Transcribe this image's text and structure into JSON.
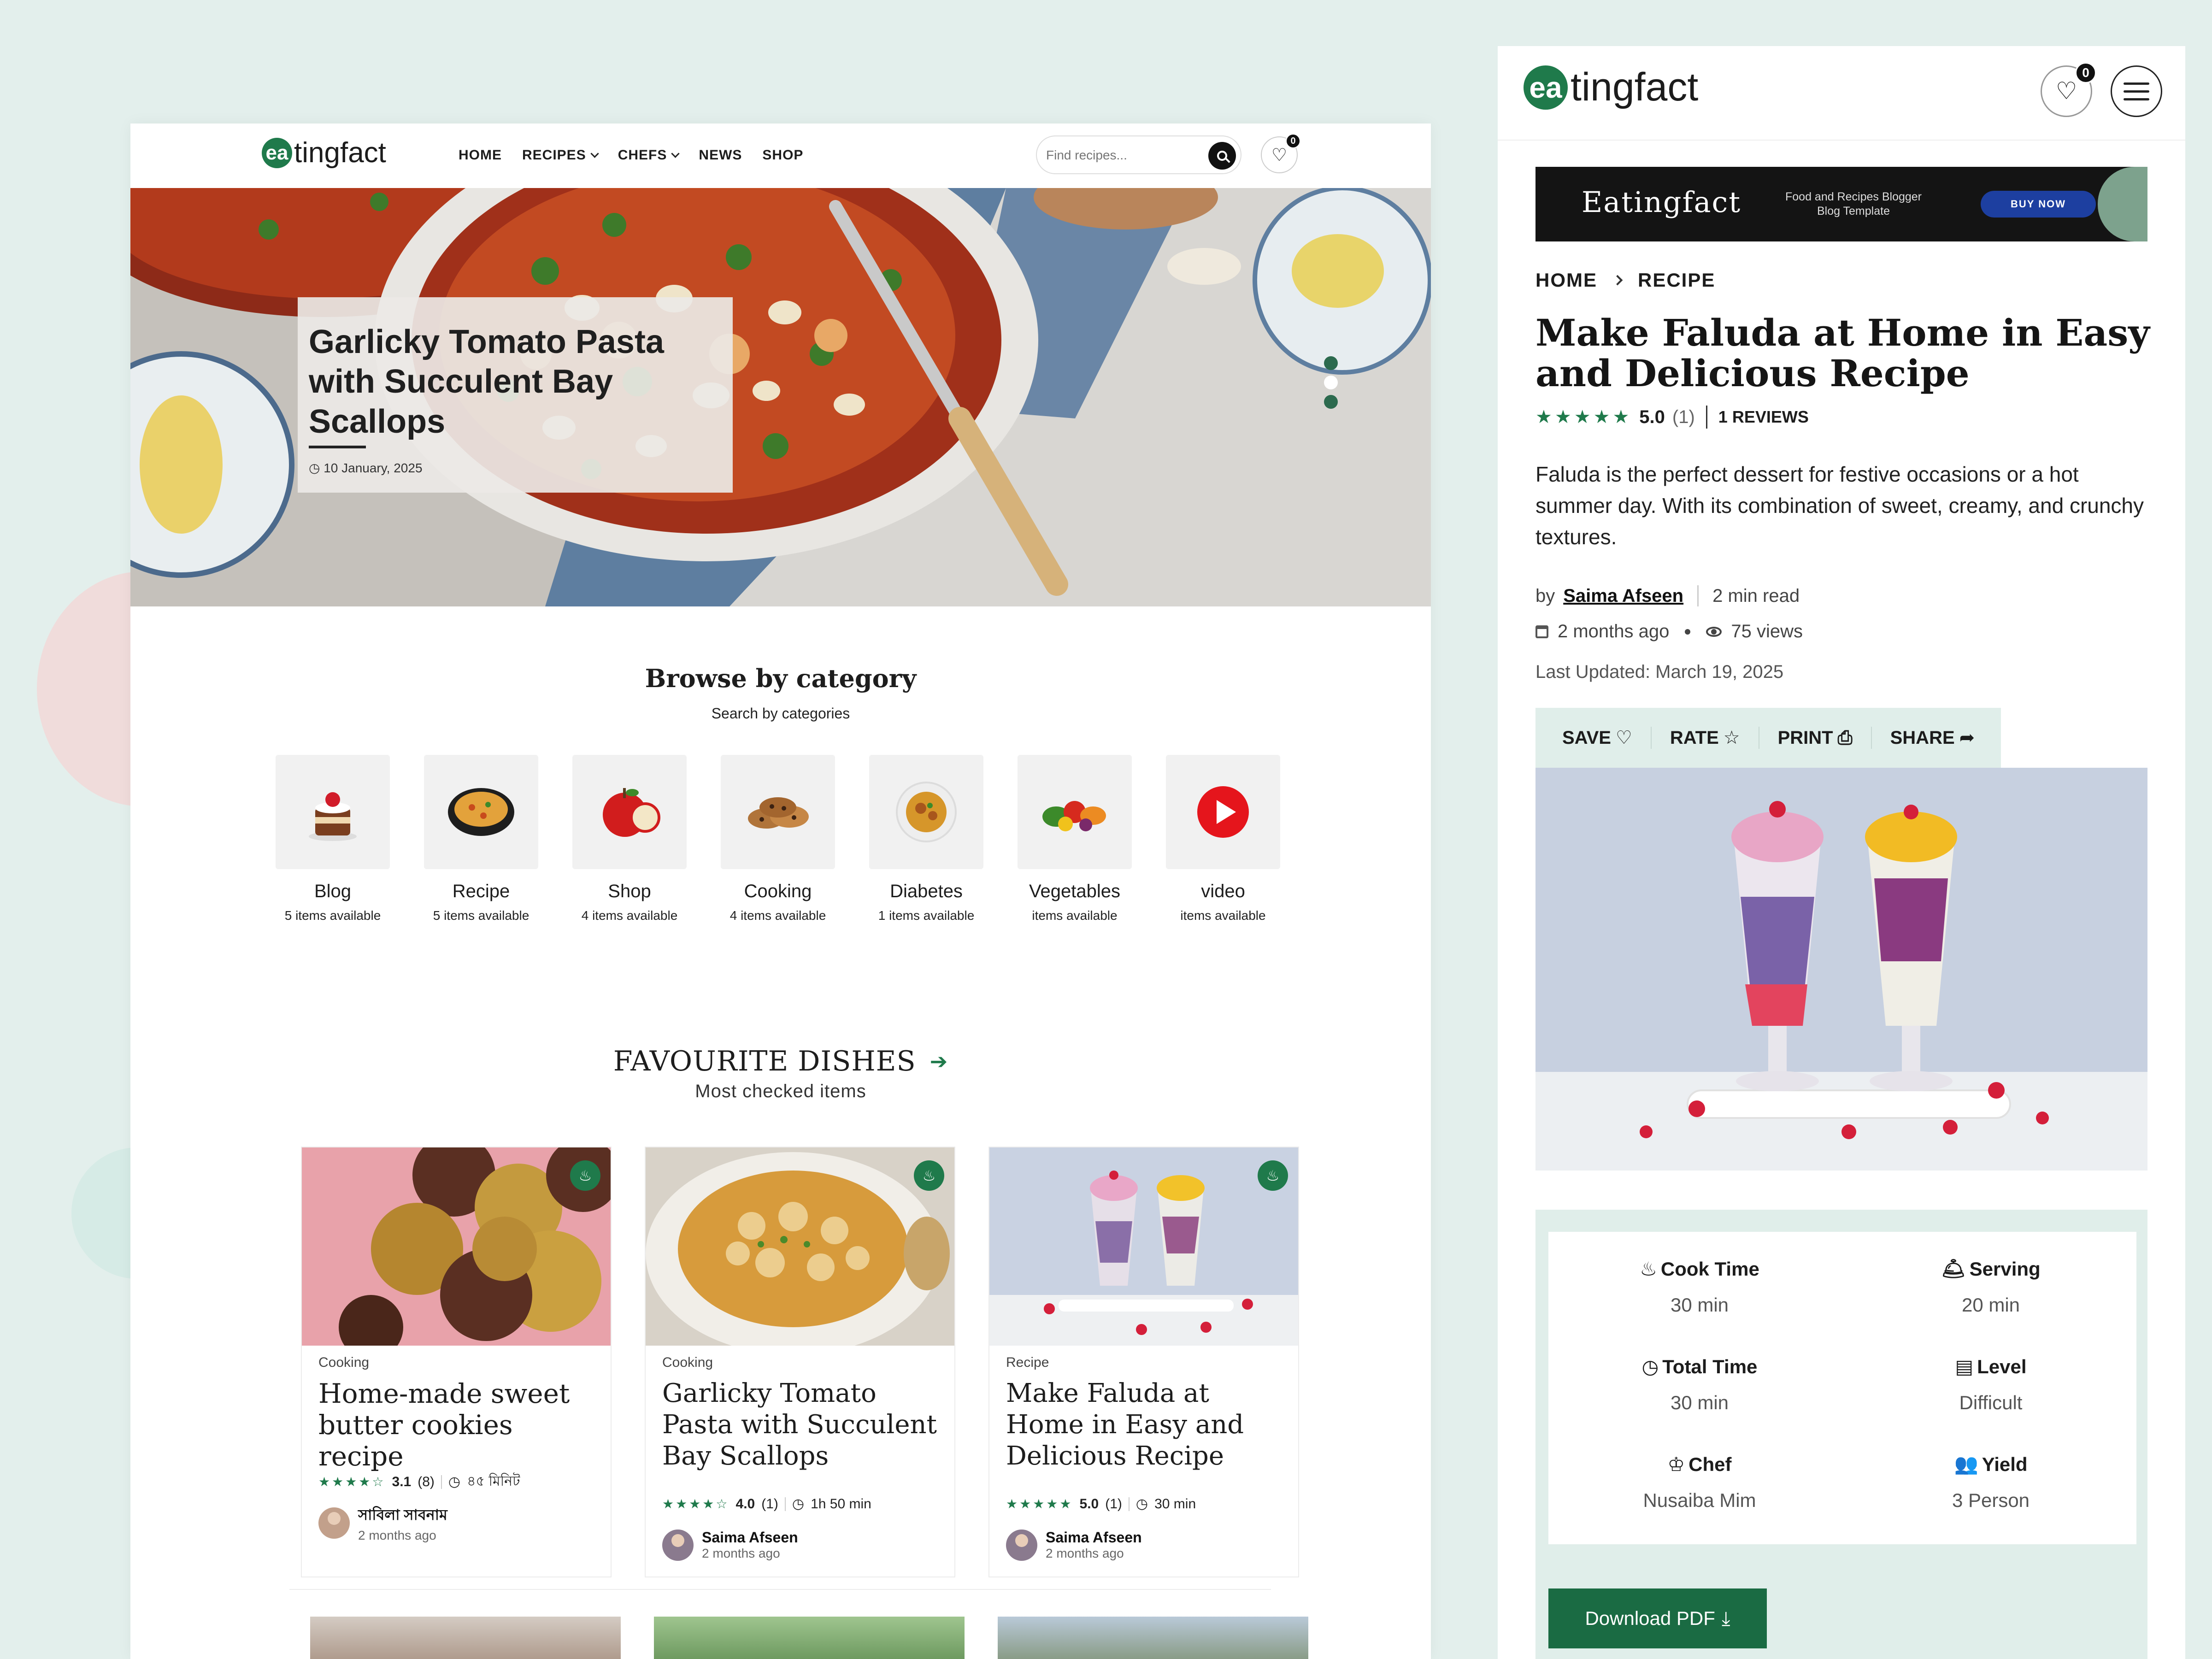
{
  "brand": {
    "badge": "ea",
    "rest": "tingfact"
  },
  "colors": {
    "accent": "#1f7a4b",
    "background": "#e3efec",
    "panel": "#e0eeea"
  },
  "left": {
    "nav": [
      {
        "label": "HOME",
        "dropdown": false
      },
      {
        "label": "RECIPES",
        "dropdown": true
      },
      {
        "label": "CHEFS",
        "dropdown": true
      },
      {
        "label": "NEWS",
        "dropdown": false
      },
      {
        "label": "SHOP",
        "dropdown": false
      }
    ],
    "search": {
      "placeholder": "Find recipes..."
    },
    "favorites_count": "0",
    "hero": {
      "title": "Garlicky Tomato Pasta with Succulent Bay Scallops",
      "date": "10 January, 2025"
    },
    "browse": {
      "title": "Browse by category",
      "subtitle": "Search by categories",
      "categories": [
        {
          "name": "Blog",
          "count_num": "5",
          "count_text": "items available",
          "icon": "cake-icon"
        },
        {
          "name": "Recipe",
          "count_num": "5",
          "count_text": "items available",
          "icon": "rice-bowl-icon"
        },
        {
          "name": "Shop",
          "count_num": "4",
          "count_text": "items available",
          "icon": "apple-icon"
        },
        {
          "name": "Cooking",
          "count_num": "4",
          "count_text": "items available",
          "icon": "cookies-icon"
        },
        {
          "name": "Diabetes",
          "count_num": "1",
          "count_text": "items available",
          "icon": "curry-plate-icon"
        },
        {
          "name": "Vegetables",
          "count_num": "",
          "count_text": "items available",
          "icon": "vegetables-icon"
        },
        {
          "name": "video",
          "count_num": "",
          "count_text": "items available",
          "icon": "play-icon"
        }
      ]
    },
    "favourites": {
      "title": "FAVOURITE DISHES",
      "subtitle": "Most checked items",
      "cards": [
        {
          "category": "Cooking",
          "title": "Home-made sweet butter cookies recipe",
          "rating": "3.1",
          "reviews": "(8)",
          "time": "৪৫ মিনিট",
          "author": "সাবিলা সাবনাম",
          "ago": "2 months ago",
          "stars": "★★★★☆"
        },
        {
          "category": "Cooking",
          "title": "Garlicky Tomato Pasta with Succulent Bay Scallops",
          "rating": "4.0",
          "reviews": "(1)",
          "time": "1h 50 min",
          "author": "Saima Afseen",
          "ago": "2 months ago",
          "stars": "★★★★☆"
        },
        {
          "category": "Recipe",
          "title": "Make Faluda at Home in Easy and Delicious Recipe",
          "rating": "5.0",
          "reviews": "(1)",
          "time": "30 min",
          "author": "Saima Afseen",
          "ago": "2 months ago",
          "stars": "★★★★★"
        }
      ]
    }
  },
  "right": {
    "favorites_count": "0",
    "banner": {
      "title": "Eatingfact",
      "subtitle": "Food and Recipes Blogger Blog Template",
      "button": "BUY NOW"
    },
    "breadcrumb": [
      "HOME",
      "RECIPE"
    ],
    "title": "Make Faluda at Home in Easy and Delicious Recipe",
    "rating": {
      "stars": "★★★★★",
      "value": "5.0",
      "count": "(1)",
      "reviews": "1 REVIEWS"
    },
    "description": "Faluda is the perfect dessert for festive occasions or a hot summer day. With its combination of sweet, creamy, and crunchy textures.",
    "byline": {
      "by": "by",
      "author": "Saima Afseen",
      "read": "2 min read"
    },
    "posted": "2 months ago",
    "views": "75 views",
    "updated": "Last Updated: March 19, 2025",
    "actions": [
      {
        "label": "SAVE",
        "icon": "♡",
        "icon_name": "heart-icon"
      },
      {
        "label": "RATE",
        "icon": "☆",
        "icon_name": "star-icon"
      },
      {
        "label": "PRINT",
        "icon": "⎙",
        "icon_name": "printer-icon"
      },
      {
        "label": "SHARE",
        "icon": "➦",
        "icon_name": "share-icon"
      }
    ],
    "stats": [
      {
        "key": "Cook Time",
        "value": "30 min",
        "icon": "♨"
      },
      {
        "key": "Serving",
        "value": "20 min",
        "icon": "🛎"
      },
      {
        "key": "Total Time",
        "value": "30 min",
        "icon": "◷"
      },
      {
        "key": "Level",
        "value": "Difficult",
        "icon": "▤"
      },
      {
        "key": "Chef",
        "value": "Nusaiba Mim",
        "icon": "♔"
      },
      {
        "key": "Yield",
        "value": "3 Person",
        "icon": "👥"
      }
    ],
    "download": "Download PDF"
  }
}
